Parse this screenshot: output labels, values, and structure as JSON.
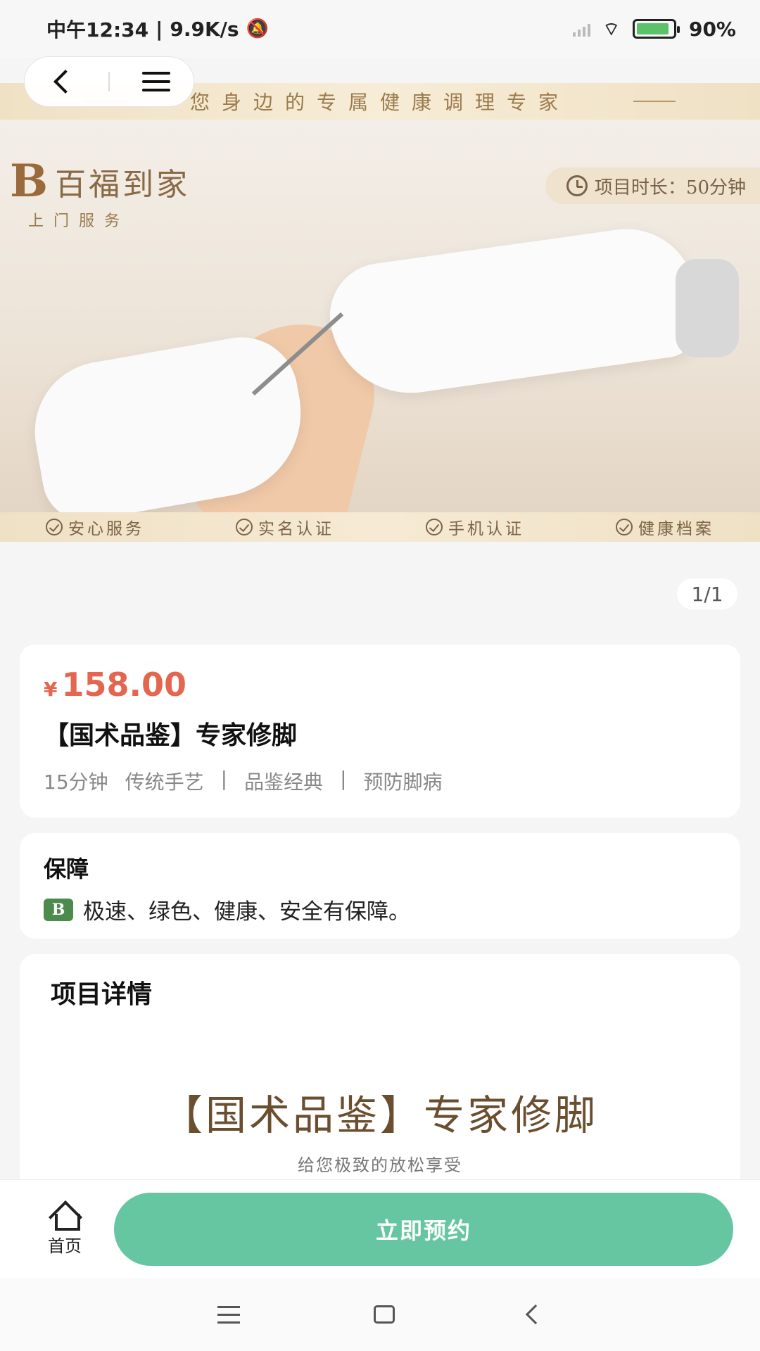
{
  "status_bar": {
    "time": "中午12:34",
    "net_speed": "9.9K/s",
    "battery": "90%"
  },
  "hero": {
    "top_banner": "您身边的专属健康调理专家",
    "brand_logo": "B",
    "brand_name": "百福到家",
    "brand_sub": "上门服务",
    "duration_tag": "项目时长：50分钟",
    "badges": [
      "安心服务",
      "实名认证",
      "手机认证",
      "健康档案"
    ]
  },
  "pager": "1/1",
  "product": {
    "currency": "¥",
    "price": "158.00",
    "title": "【国术品鉴】专家修脚",
    "duration": "15分钟",
    "tags": [
      "传统手艺",
      "品鉴经典",
      "预防脚病"
    ],
    "tag_separator": "|"
  },
  "guarantee": {
    "title": "保障",
    "logo": "B",
    "text": "极速、绿色、健康、安全有保障。"
  },
  "detail": {
    "title": "项目详情",
    "headline": "【国术品鉴】专家修脚",
    "subline": "给您极致的放松享受"
  },
  "action_bar": {
    "home_label": "首页",
    "book_label": "立即预约"
  },
  "colors": {
    "price": "#e4664f",
    "book_button": "#67c6a2",
    "gold": "#9b7a4c"
  }
}
